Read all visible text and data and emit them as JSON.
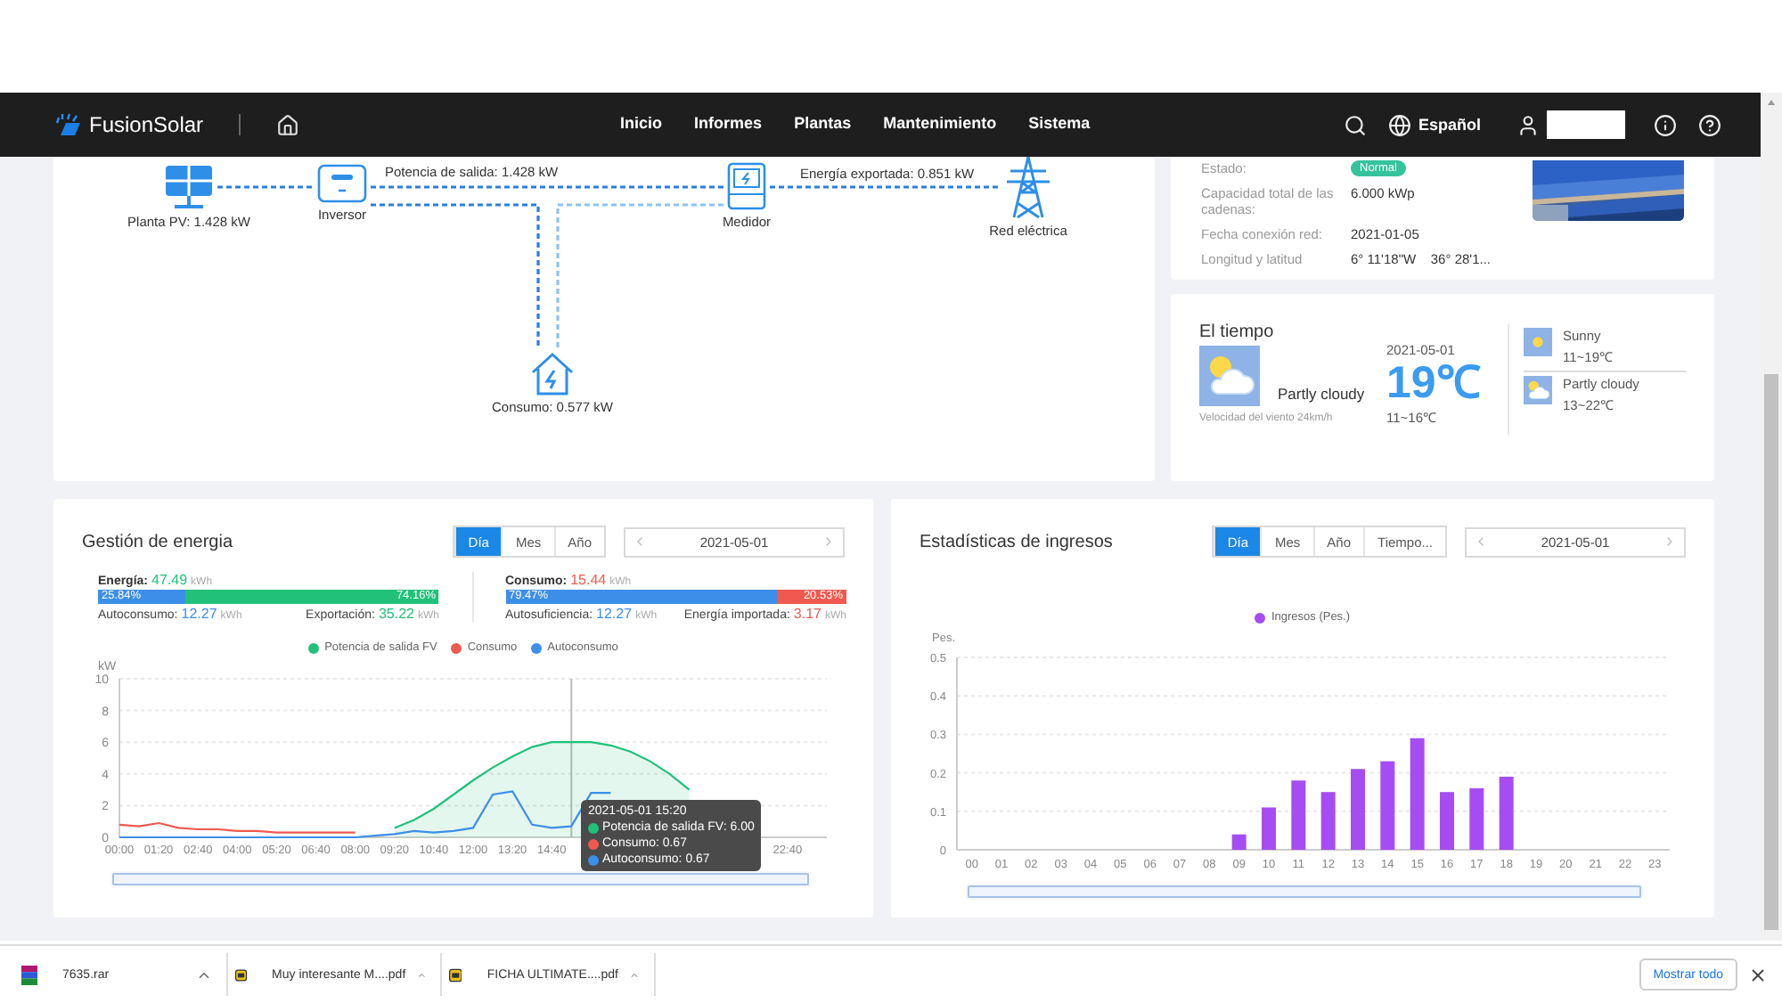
{
  "header": {
    "brand": "FusionSolar",
    "nav": [
      {
        "label": "Inicio",
        "selected": false
      },
      {
        "label": "Informes",
        "selected": false
      },
      {
        "label": "Plantas",
        "selected": false
      },
      {
        "label": "Mantenimiento",
        "selected": false
      },
      {
        "label": "Sistema",
        "selected": false
      }
    ],
    "language": "Español"
  },
  "flow": {
    "nodes": [
      {
        "kind": "pv",
        "label": "Planta PV: 1.428 kW"
      },
      {
        "kind": "inverter",
        "label": "Inversor"
      },
      {
        "kind": "meter",
        "label": "Medidor"
      },
      {
        "kind": "grid",
        "label": "Red eléctrica"
      },
      {
        "kind": "home",
        "label": "Consumo: 0.577 kW"
      }
    ],
    "edges": [
      {
        "label": "Potencia de salida: 1.428 kW"
      },
      {
        "label": "Energía exportada: 0.851 kW"
      }
    ]
  },
  "plant": {
    "fields": [
      {
        "label": "Estado:",
        "value": "Normal",
        "kind": "badge"
      },
      {
        "label": "Capacidad total de las cadenas:",
        "value": "6.000 kWp",
        "kind": "text"
      },
      {
        "label": "Fecha conexión red:",
        "value": "2021-01-05",
        "kind": "text"
      },
      {
        "label": "Longitud y latitud",
        "value": "6° 11'18\"W    36° 28'1...",
        "kind": "text"
      }
    ]
  },
  "weather": {
    "title": "El tiempo",
    "kind": "partly_cloudy",
    "condition": "Partly cloudy",
    "wind": "Velocidad del viento 24km/h",
    "date": "2021-05-01",
    "temperature": "19℃",
    "range": "11~16℃",
    "forecast": [
      {
        "kind": "sunny",
        "condition": "Sunny",
        "range": "11~19℃"
      },
      {
        "kind": "partly_cloudy",
        "condition": "Partly cloudy",
        "range": "13~22℃"
      }
    ]
  },
  "energy": {
    "title": "Gestión de energia",
    "tabs": [
      {
        "label": "Día",
        "selected": true
      },
      {
        "label": "Mes",
        "selected": false
      },
      {
        "label": "Año",
        "selected": false
      }
    ],
    "date": "2021-05-01",
    "summary": [
      {
        "label": "Energía:",
        "value": "47.49",
        "unit": "kWh",
        "color": "#21c17a",
        "bar": [
          {
            "text": "25.84%",
            "level": 0.2584,
            "color": "#3d8ee8"
          },
          {
            "text": "74.16%",
            "level": 0.7416,
            "color": "#21c17a"
          }
        ],
        "parts": [
          {
            "label": "Autoconsumo:",
            "value": "12.27",
            "unit": "kWh",
            "color": "#3d8ee8"
          },
          {
            "label": "Exportación:",
            "value": "35.22",
            "unit": "kWh",
            "color": "#21c17a"
          }
        ]
      },
      {
        "label": "Consumo:",
        "value": "15.44",
        "unit": "kWh",
        "color": "#f0594f",
        "bar": [
          {
            "text": "79.47%",
            "level": 0.7947,
            "color": "#3d8ee8"
          },
          {
            "text": "20.53%",
            "level": 0.2053,
            "color": "#f0594f"
          }
        ],
        "parts": [
          {
            "label": "Autosuficiencia:",
            "value": "12.27",
            "unit": "kWh",
            "color": "#3d8ee8"
          },
          {
            "label": "Energía importada:",
            "value": "3.17",
            "unit": "kWh",
            "color": "#f0594f"
          }
        ]
      }
    ],
    "chart_data": {
      "type": "line",
      "grid": true,
      "ylabel": "kW",
      "ylim": [
        0,
        10
      ],
      "yticks": [
        0,
        2,
        4,
        6,
        8,
        10
      ],
      "xlim": [
        0,
        1440
      ],
      "x": [
        0,
        40,
        80,
        120,
        160,
        200,
        240,
        280,
        320,
        360,
        400,
        440,
        480,
        520,
        560,
        600,
        640,
        680,
        720,
        760,
        800,
        840,
        880,
        920,
        960,
        1000,
        1040,
        1080,
        1120,
        1160
      ],
      "ref_lines": [
        {
          "axis": "x",
          "value": 920
        }
      ],
      "xticks": [
        {
          "value": 0,
          "label": "00:00"
        },
        {
          "value": 80,
          "label": "01:20"
        },
        {
          "value": 160,
          "label": "02:40"
        },
        {
          "value": 240,
          "label": "04:00"
        },
        {
          "value": 320,
          "label": "05:20"
        },
        {
          "value": 400,
          "label": "06:40"
        },
        {
          "value": 480,
          "label": "08:00"
        },
        {
          "value": 560,
          "label": "09:20"
        },
        {
          "value": 640,
          "label": "10:40"
        },
        {
          "value": 720,
          "label": "12:00"
        },
        {
          "value": 800,
          "label": "13:20"
        },
        {
          "value": 880,
          "label": "14:40"
        },
        {
          "value": 1360,
          "label": "22:40"
        }
      ],
      "series": [
        {
          "name": "Potencia de salida FV",
          "color": "#21c17a",
          "values": [
            null,
            null,
            null,
            null,
            null,
            null,
            null,
            null,
            null,
            null,
            null,
            null,
            null,
            null,
            0.6,
            1.1,
            1.8,
            2.7,
            3.6,
            4.4,
            5.1,
            5.7,
            6.0,
            6.0,
            6.0,
            5.8,
            5.4,
            4.8,
            4.0,
            3.0
          ]
        },
        {
          "name": "Consumo",
          "color": "#f0594f",
          "values": [
            0.8,
            0.7,
            0.9,
            0.6,
            0.5,
            0.5,
            0.4,
            0.4,
            0.3,
            0.3,
            0.3,
            0.3,
            0.3,
            null,
            null,
            null,
            null,
            null,
            null,
            null,
            null,
            null,
            null,
            null,
            null,
            null,
            null,
            null,
            null,
            null
          ]
        },
        {
          "name": "Autoconsumo",
          "color": "#3d8ee8",
          "values": [
            0,
            0,
            0,
            0,
            0,
            0,
            0,
            0,
            0,
            0,
            0,
            0,
            0,
            0.1,
            0.2,
            0.4,
            0.3,
            0.4,
            0.6,
            2.7,
            2.9,
            0.8,
            0.6,
            0.7,
            2.8,
            2.8,
            null,
            null,
            null,
            null
          ]
        }
      ]
    },
    "zoom": {
      "level": 1
    },
    "tooltip": {
      "title": "2021-05-01 15:20",
      "rows": [
        {
          "text": "Potencia de salida FV: 6.00",
          "color": "#21c17a"
        },
        {
          "text": "Consumo: 0.67",
          "color": "#f0594f"
        },
        {
          "text": "Autoconsumo: 0.67",
          "color": "#3d8ee8"
        }
      ]
    }
  },
  "income": {
    "title": "Estadísticas de ingresos",
    "tabs": [
      {
        "label": "Día",
        "selected": true
      },
      {
        "label": "Mes",
        "selected": false
      },
      {
        "label": "Año",
        "selected": false
      },
      {
        "label": "Tiempo...",
        "selected": false
      }
    ],
    "date": "2021-05-01",
    "zoom": {
      "level": 1
    },
    "chart_data": {
      "type": "bar",
      "grid": true,
      "ylabel": "Pes.",
      "ylim": [
        0,
        0.5
      ],
      "yticks": [
        0,
        0.1,
        0.2,
        0.3,
        0.4,
        0.5
      ],
      "categories": [
        "00",
        "01",
        "02",
        "03",
        "04",
        "05",
        "06",
        "07",
        "08",
        "09",
        "10",
        "11",
        "12",
        "13",
        "14",
        "15",
        "16",
        "17",
        "18",
        "19",
        "20",
        "21",
        "22",
        "23"
      ],
      "series": [
        {
          "name": "Ingresos (Pes.)",
          "color": "#a54df2",
          "values": [
            0,
            0,
            0,
            0,
            0,
            0,
            0,
            0,
            0,
            0.04,
            0.11,
            0.18,
            0.15,
            0.21,
            0.23,
            0.29,
            0.15,
            0.16,
            0.19,
            0,
            0,
            0,
            0,
            0
          ]
        }
      ]
    }
  },
  "downloads": {
    "items": [
      {
        "kind": "archive",
        "name": "7635.rar"
      },
      {
        "kind": "pdf",
        "name": "Muy interesante M....pdf"
      },
      {
        "kind": "pdf",
        "name": "FICHA ULTIMATE....pdf"
      }
    ],
    "show_all": "Mostrar todo"
  }
}
